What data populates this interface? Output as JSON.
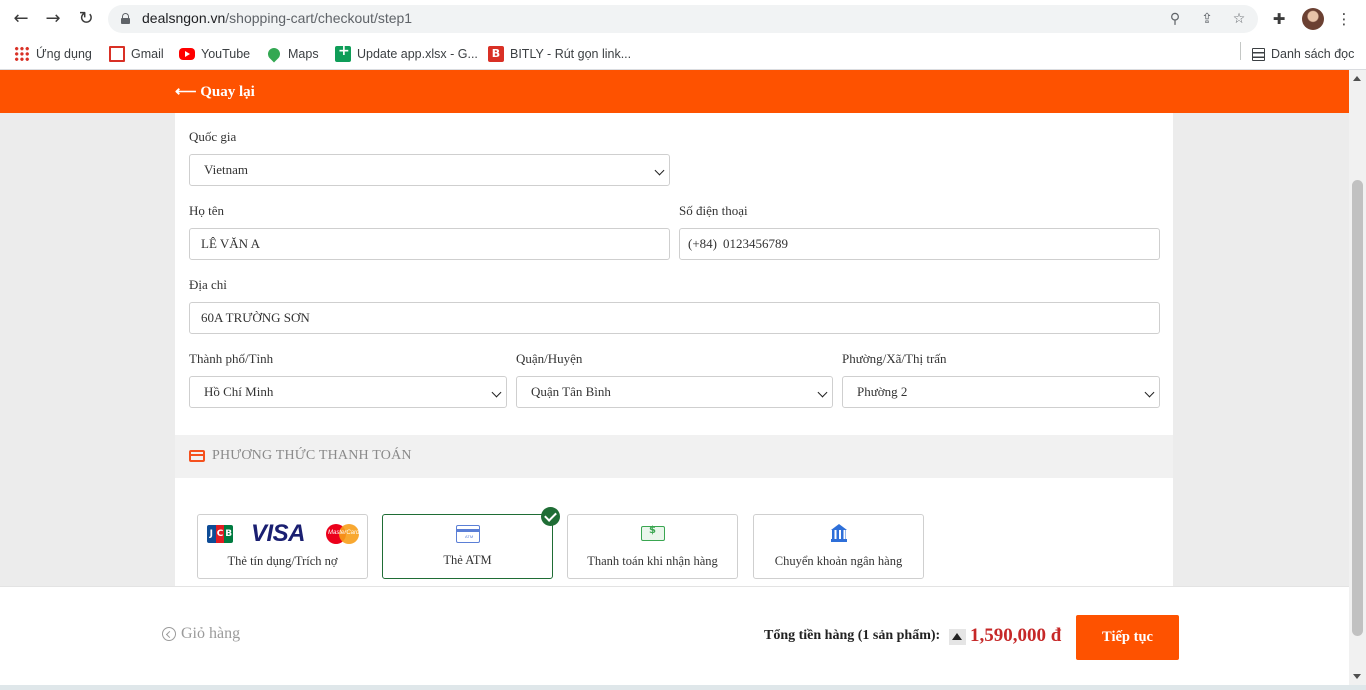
{
  "browser": {
    "url_domain": "dealsngon.vn",
    "url_path": "/shopping-cart/checkout/step1",
    "bookmarks": [
      {
        "label": "Ứng dụng"
      },
      {
        "label": "Gmail"
      },
      {
        "label": "YouTube"
      },
      {
        "label": "Maps"
      },
      {
        "label": "Update app.xlsx - G..."
      },
      {
        "label": "BITLY - Rút gọn link..."
      }
    ],
    "reading_list": "Danh sách đọc"
  },
  "header": {
    "back_label": "⟵ Quay lại"
  },
  "form": {
    "country_label": "Quốc gia",
    "country_value": "Vietnam",
    "name_label": "Họ tên",
    "name_value": "LÊ VĂN A",
    "phone_label": "Số điện thoại",
    "phone_prefix": "(+84)",
    "phone_value": "0123456789",
    "address_label": "Địa chỉ",
    "address_value": "60A TRƯỜNG SƠN",
    "city_label": "Thành phố/Tỉnh",
    "city_value": "Hồ Chí Minh",
    "district_label": "Quận/Huyện",
    "district_value": "Quận Tân Bình",
    "ward_label": "Phường/Xã/Thị trấn",
    "ward_value": "Phường 2"
  },
  "payment": {
    "title": "PHƯƠNG THỨC THANH TOÁN",
    "methods": [
      {
        "label": "Thẻ tín dụng/Trích nợ",
        "selected": false
      },
      {
        "label": "Thẻ ATM",
        "selected": true
      },
      {
        "label": "Thanh toán khi nhận hàng",
        "selected": false
      },
      {
        "label": "Chuyển khoản ngân hàng",
        "selected": false
      }
    ],
    "card_logos": {
      "jcb": [
        "J",
        "C",
        "B"
      ],
      "visa": "VISA",
      "mastercard": "MasterCard"
    }
  },
  "footer": {
    "cart_label": "Giỏ hàng",
    "total_label": "Tổng tiền hàng (1 sản phẩm):",
    "total_amount": "1,590,000 đ",
    "continue_label": "Tiếp tục"
  },
  "colors": {
    "brand_orange": "#fe5200",
    "selected_green": "#1f6d35",
    "price_red": "#c62828"
  }
}
